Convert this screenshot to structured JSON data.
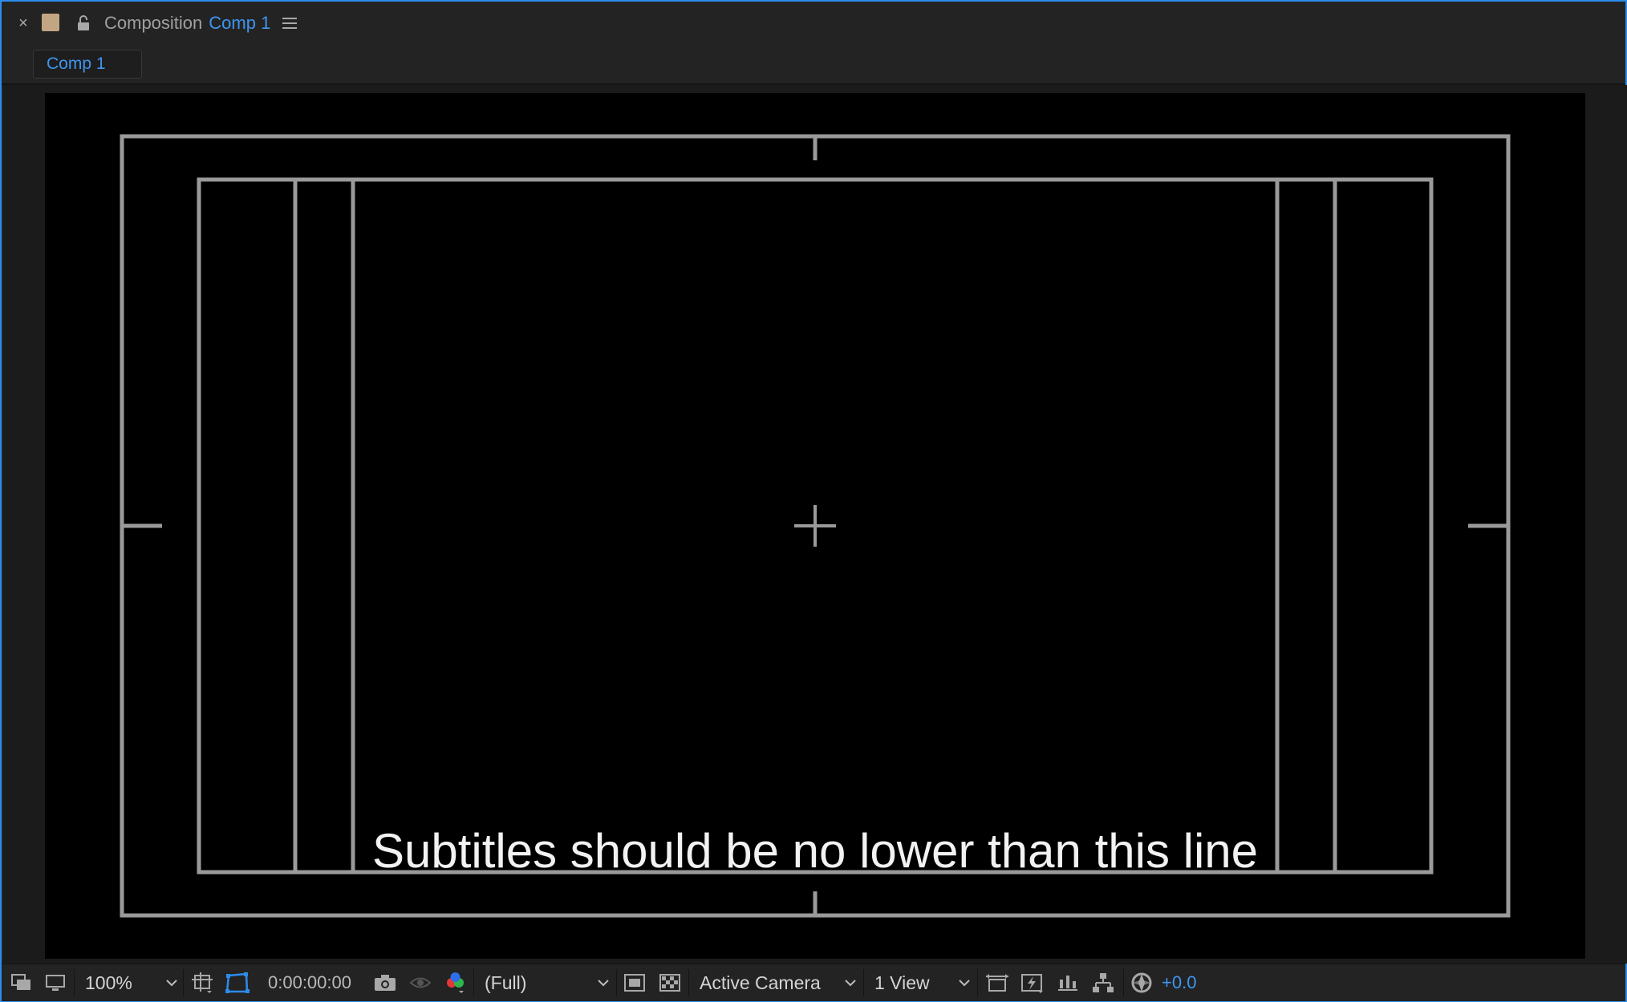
{
  "panel": {
    "title_prefix": "Composition",
    "comp_name": "Comp 1",
    "label_color": "#c2a582",
    "accent_color": "#3f95f0"
  },
  "tabs": [
    {
      "label": "Comp 1",
      "active": true
    }
  ],
  "viewer": {
    "background": "#000000",
    "guide_color": "#9a9a9a",
    "subtitle_note": "Subtitles should be no lower than this line"
  },
  "toolbar": {
    "zoom": "100%",
    "timecode": "0:00:00:00",
    "resolution": "(Full)",
    "camera": "Active Camera",
    "views": "1 View",
    "exposure": "+0.0",
    "icons": [
      "always-preview-icon",
      "monitor-icon",
      "region-of-interest-icon",
      "transparency-grid-icon",
      "snapshot-camera-icon",
      "show-snapshot-icon",
      "color-channels-icon",
      "fast-preview-icon",
      "toggle-mask-icon",
      "draft-3d-icon",
      "flowchart-icon",
      "timeline-icon",
      "exposure-reset-icon"
    ]
  }
}
